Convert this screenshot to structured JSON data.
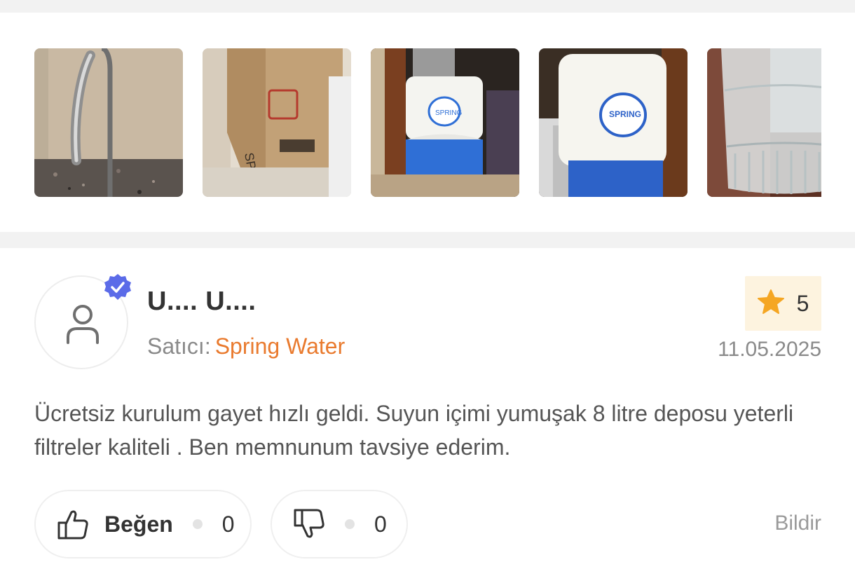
{
  "gallery": {
    "images": [
      {
        "alt": "faucet-photo"
      },
      {
        "alt": "cardboard-box-photo"
      },
      {
        "alt": "water-purifier-under-sink-photo"
      },
      {
        "alt": "water-purifier-closeup-photo"
      },
      {
        "alt": "glass-of-water-photo"
      }
    ]
  },
  "review": {
    "user_name": "U.... U....",
    "seller_label": "Satıcı:",
    "seller_name": "Spring Water",
    "rating": "5",
    "date": "11.05.2025",
    "text": "Ücretsiz kurulum gayet hızlı geldi. Suyun içimi yumuşak 8 litre deposu yeterli filtreler kaliteli . Ben memnunum tavsiye ederim.",
    "like_label": "Beğen",
    "like_count": "0",
    "dislike_count": "0",
    "report_label": "Bildir"
  },
  "colors": {
    "accent": "#e97a2e",
    "star": "#f5a623",
    "verified": "#5b6be8",
    "rating_bg": "#fdf3df"
  },
  "icons": {
    "avatar": "person-icon",
    "verified": "verified-badge-icon",
    "rating": "star-icon",
    "like": "thumbs-up-icon",
    "dislike": "thumbs-down-icon"
  }
}
